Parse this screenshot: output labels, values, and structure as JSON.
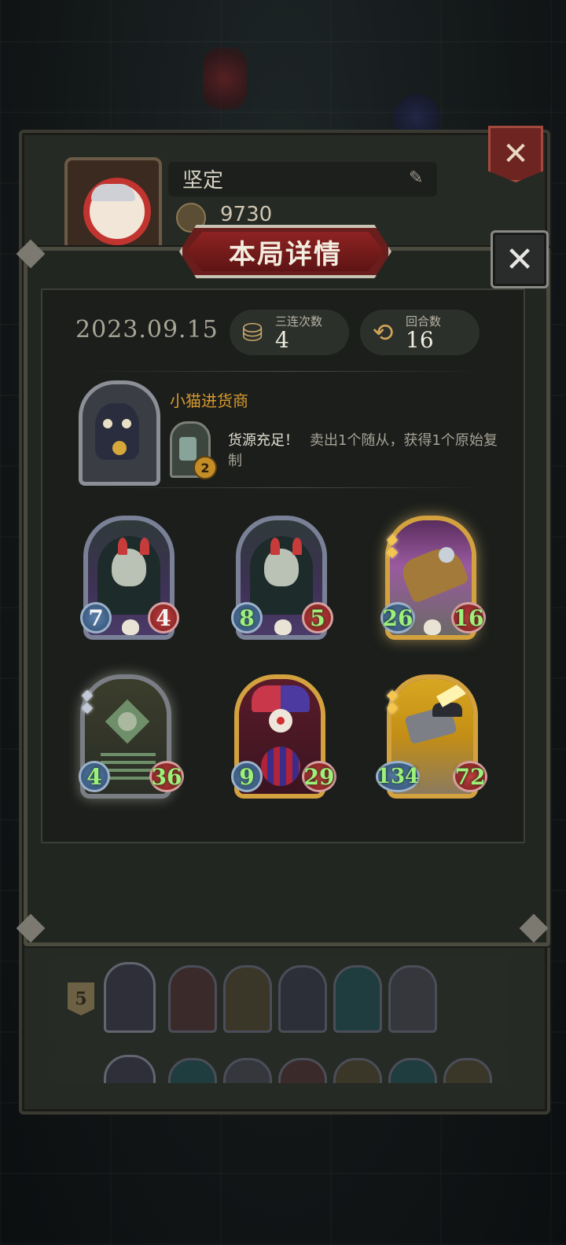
{
  "profile": {
    "name": "坚定",
    "coins": "9730"
  },
  "modal": {
    "title": "本局详情",
    "date": "2023.09.15",
    "stats": [
      {
        "label": "三连次数",
        "value": "4",
        "icon": "triple-merge-icon"
      },
      {
        "label": "回合数",
        "value": "16",
        "icon": "turn-cycle-icon"
      }
    ],
    "hero": {
      "name": "小猫进货商",
      "item_count": "2",
      "skill_title": "货源充足！",
      "skill_desc_line1": "卖出1个随从，获得1个原始复",
      "skill_desc_line2": "制"
    },
    "minions": [
      {
        "art": "elf-demon",
        "attack": "7",
        "health": "4",
        "attack_buffed": false,
        "health_buffed": false,
        "tier": "normal"
      },
      {
        "art": "elf-demon",
        "attack": "8",
        "health": "5",
        "attack_buffed": true,
        "health_buffed": true,
        "tier": "normal"
      },
      {
        "art": "mech-train",
        "attack": "26",
        "health": "16",
        "attack_buffed": true,
        "health_buffed": true,
        "tier": "golden"
      },
      {
        "art": "ghost-skeleton",
        "attack": "4",
        "health": "36",
        "attack_buffed": true,
        "health_buffed": true,
        "tier": "silver"
      },
      {
        "art": "clown",
        "attack": "9",
        "health": "29",
        "attack_buffed": true,
        "health_buffed": true,
        "tier": "normal"
      },
      {
        "art": "cannon",
        "attack": "134",
        "health": "72",
        "attack_buffed": true,
        "health_buffed": true,
        "tier": "normal"
      }
    ]
  },
  "history": {
    "rows": [
      {
        "tier": "5"
      },
      {
        "tier": ""
      }
    ]
  },
  "colors": {
    "accent_gold": "#d99a2f",
    "buffed_stat": "#9df07a",
    "ribbon_red": "#8d2322"
  }
}
